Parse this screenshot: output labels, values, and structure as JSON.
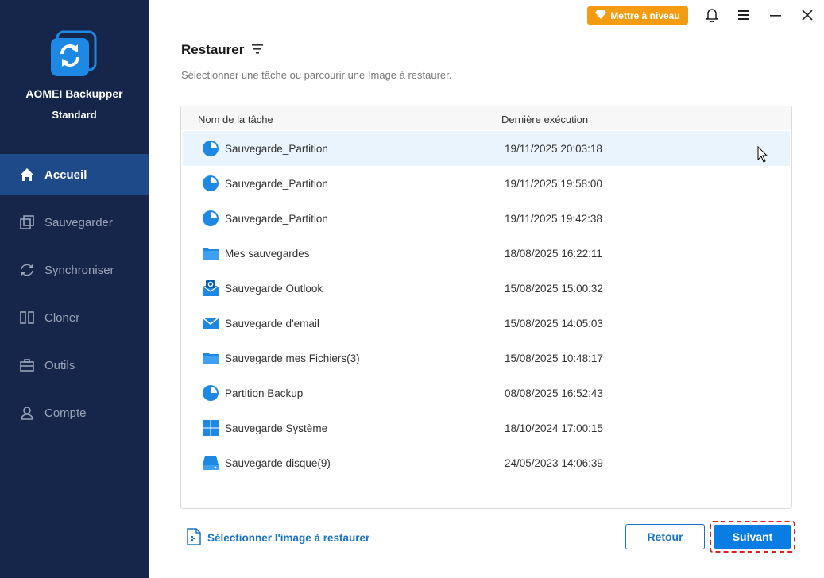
{
  "app": {
    "name": "AOMEI Backupper",
    "edition": "Standard"
  },
  "sidebar": {
    "items": [
      {
        "label": "Accueil",
        "icon": "home-icon",
        "active": true
      },
      {
        "label": "Sauvegarder",
        "icon": "backup-icon",
        "active": false
      },
      {
        "label": "Synchroniser",
        "icon": "sync-icon",
        "active": false
      },
      {
        "label": "Cloner",
        "icon": "clone-icon",
        "active": false
      },
      {
        "label": "Outils",
        "icon": "tools-icon",
        "active": false
      },
      {
        "label": "Compte",
        "icon": "user-icon",
        "active": false
      }
    ]
  },
  "topbar": {
    "upgrade_label": "Mettre à niveau"
  },
  "main": {
    "title": "Restaurer",
    "subtitle": "Sélectionner une tâche ou parcourir une Image à restaurer.",
    "table": {
      "headers": [
        "Nom de la tâche",
        "Dernière exécution"
      ],
      "rows": [
        {
          "name": "Sauvegarde_Partition",
          "date": "19/11/2025 20:03:18",
          "icon": "partition-icon",
          "selected": true
        },
        {
          "name": "Sauvegarde_Partition",
          "date": "19/11/2025 19:58:00",
          "icon": "partition-icon"
        },
        {
          "name": "Sauvegarde_Partition",
          "date": "19/11/2025 19:42:38",
          "icon": "partition-icon"
        },
        {
          "name": "Mes sauvegardes",
          "date": "18/08/2025 16:22:11",
          "icon": "folder-icon"
        },
        {
          "name": "Sauvegarde Outlook",
          "date": "15/08/2025 15:00:32",
          "icon": "outlook-icon"
        },
        {
          "name": "Sauvegarde d'email",
          "date": "15/08/2025 14:05:03",
          "icon": "mail-icon"
        },
        {
          "name": "Sauvegarde mes Fichiers(3)",
          "date": "15/08/2025 10:48:17",
          "icon": "folder-icon"
        },
        {
          "name": "Partition Backup",
          "date": "08/08/2025 16:52:43",
          "icon": "partition-icon"
        },
        {
          "name": "Sauvegarde Système",
          "date": "18/10/2024 17:00:15",
          "icon": "windows-icon"
        },
        {
          "name": "Sauvegarde disque(9)",
          "date": "24/05/2023 14:06:39",
          "icon": "disk-icon"
        }
      ]
    },
    "select_image_label": "Sélectionner l'image à restaurer",
    "back_label": "Retour",
    "next_label": "Suivant"
  },
  "colors": {
    "sidebar_bg": "#15264a",
    "accent": "#0a7de4",
    "upgrade": "#f39c12",
    "selected_row": "#e9f4fd"
  }
}
